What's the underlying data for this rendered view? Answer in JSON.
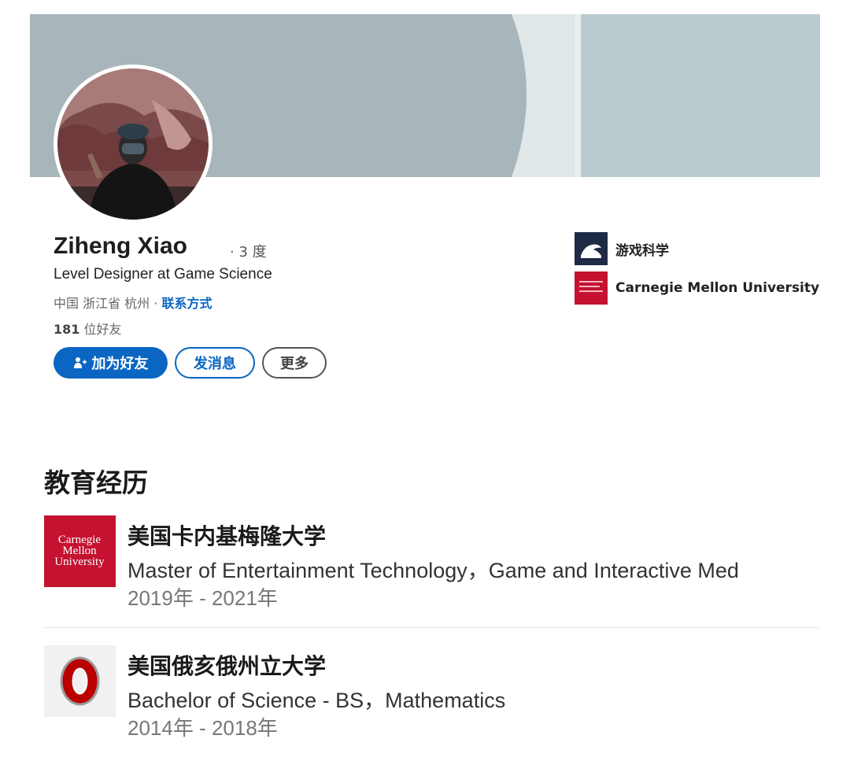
{
  "profile": {
    "name": "Ziheng Xiao",
    "degree": "· 3 度",
    "headline": "Level Designer at Game Science",
    "location": "中国 浙江省 杭州 · ",
    "contact_link": "联系方式",
    "friends_count": "181",
    "friends_label": " 位好友"
  },
  "actions": {
    "add_friend": "加为好友",
    "message": "发消息",
    "more": "更多"
  },
  "orgs": [
    {
      "name": "游戏科学",
      "logo_icon": "game-science-logo"
    },
    {
      "name": "Carnegie Mellon University",
      "logo_icon": "cmu-logo"
    }
  ],
  "education": {
    "title": "教育经历",
    "items": [
      {
        "school": "美国卡内基梅隆大学",
        "degree": "Master of Entertainment Technology，Game and Interactive Med",
        "dates": "2019年 - 2021年",
        "logo_icon": "cmu-logo",
        "logo_text": [
          "Carnegie",
          "Mellon",
          "University"
        ]
      },
      {
        "school": "美国俄亥俄州立大学",
        "degree": "Bachelor of Science - BS，Mathematics",
        "dates": "2014年 - 2018年",
        "logo_icon": "ohio-state-logo"
      }
    ]
  },
  "colors": {
    "accent": "#0a66c2",
    "banner": "#a9b6bb",
    "cmu_red": "#c41230",
    "osu_red": "#bb0000"
  }
}
